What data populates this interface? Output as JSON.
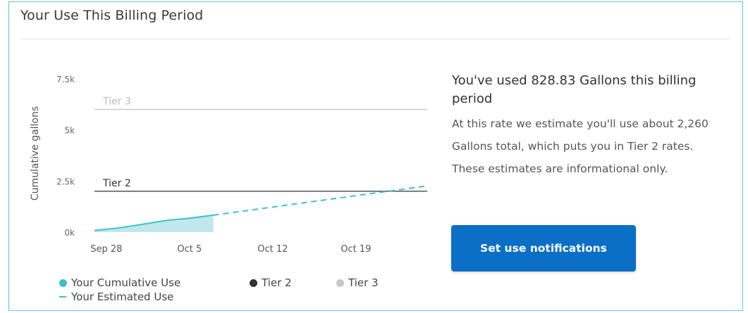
{
  "header": {
    "title": "Your Use This Billing Period"
  },
  "summary": {
    "heading": "You've used 828.83 Gallons this billing period",
    "body": "At this rate we estimate you'll use about 2,260 Gallons total, which puts you in Tier 2 rates. These estimates are informational only."
  },
  "actions": {
    "notify_label": "Set use notifications"
  },
  "colors": {
    "cumulative": "#3cc0cc",
    "cumulative_fill": "#bfe8ec",
    "estimated": "#3cc0cc",
    "tier2": "#555555",
    "tier3": "#c8c8c8",
    "button": "#0b6fc6",
    "border": "#5bc8d6"
  },
  "legend": {
    "cumulative": "Your Cumulative Use",
    "tier2": "Tier 2",
    "tier3": "Tier 3",
    "estimated": "Your Estimated Use"
  },
  "chart_data": {
    "type": "area",
    "ylabel": "Cumulative gallons",
    "y_ticks": [
      {
        "value": 0,
        "label": "0k"
      },
      {
        "value": 2500,
        "label": "2.5k"
      },
      {
        "value": 5000,
        "label": "5k"
      },
      {
        "value": 7500,
        "label": "7.5k"
      }
    ],
    "x_ticks": [
      {
        "value": "2023-09-28",
        "label": "Sep 28"
      },
      {
        "value": "2023-10-05",
        "label": "Oct 5"
      },
      {
        "value": "2023-10-12",
        "label": "Oct 12"
      },
      {
        "value": "2023-10-19",
        "label": "Oct 19"
      }
    ],
    "xlim": [
      "2023-09-27",
      "2023-10-25"
    ],
    "ylim": [
      0,
      7500
    ],
    "thresholds": [
      {
        "name": "Tier 2",
        "label": "Tier 2",
        "value": 2000
      },
      {
        "name": "Tier 3",
        "label": "Tier 3",
        "value": 6000
      }
    ],
    "series": [
      {
        "name": "Your Cumulative Use",
        "style": "area",
        "points": [
          {
            "x": "2023-09-27",
            "y": 80
          },
          {
            "x": "2023-09-29",
            "y": 200
          },
          {
            "x": "2023-10-01",
            "y": 380
          },
          {
            "x": "2023-10-03",
            "y": 570
          },
          {
            "x": "2023-10-05",
            "y": 680
          },
          {
            "x": "2023-10-07",
            "y": 829
          }
        ]
      },
      {
        "name": "Your Estimated Use",
        "style": "dashed",
        "points": [
          {
            "x": "2023-10-07",
            "y": 829
          },
          {
            "x": "2023-10-25",
            "y": 2260
          }
        ]
      }
    ],
    "grid": false,
    "legend_position": "bottom"
  }
}
